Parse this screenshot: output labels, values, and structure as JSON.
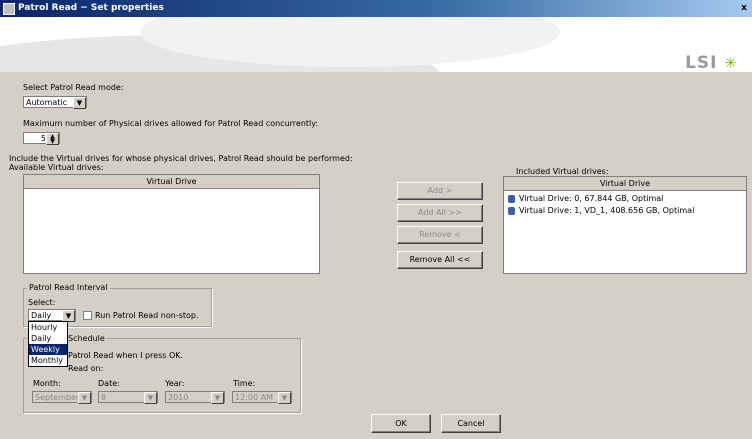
{
  "window": {
    "title": "Patrol Read − Set properties",
    "close_label": "x"
  },
  "banner": {
    "logo_text": "LSI"
  },
  "mode": {
    "label": "Select Patrol Read mode:",
    "value": "Automatic"
  },
  "max_drives": {
    "label": "Maximum number of Physical drives allowed for Patrol Read concurrently:",
    "value": "5"
  },
  "include_label": "Include the Virtual drives for whose physical drives, Patrol Read should be performed:",
  "available": {
    "label": "Available Virtual drives:",
    "column": "Virtual Drive",
    "rows": []
  },
  "included": {
    "label": "Included Virtual drives:",
    "column": "Virtual Drive",
    "rows": [
      "Virtual Drive: 0, 67.844 GB, Optimal",
      "Virtual Drive: 1, VD_1, 408.656 GB, Optimal"
    ]
  },
  "buttons": {
    "add": "Add >",
    "add_all": "Add All >>",
    "remove": "Remove <",
    "remove_all": "Remove All <<",
    "ok": "OK",
    "cancel": "Cancel"
  },
  "interval": {
    "group_label": "Patrol Read Interval",
    "select_label": "Select:",
    "value": "Daily",
    "options": [
      "Hourly",
      "Daily",
      "Weekly",
      "Monthly"
    ],
    "highlighted": "Weekly",
    "nonstop_label": "Run Patrol Read non-stop."
  },
  "schedule": {
    "group_label": "Schedule",
    "start_text": "Patrol Read when I press OK.",
    "read_on": "Read on:",
    "month_label": "Month:",
    "date_label": "Date:",
    "year_label": "Year:",
    "time_label": "Time:",
    "month": "September",
    "date": "8",
    "year": "2010",
    "time": "12:00 AM"
  }
}
